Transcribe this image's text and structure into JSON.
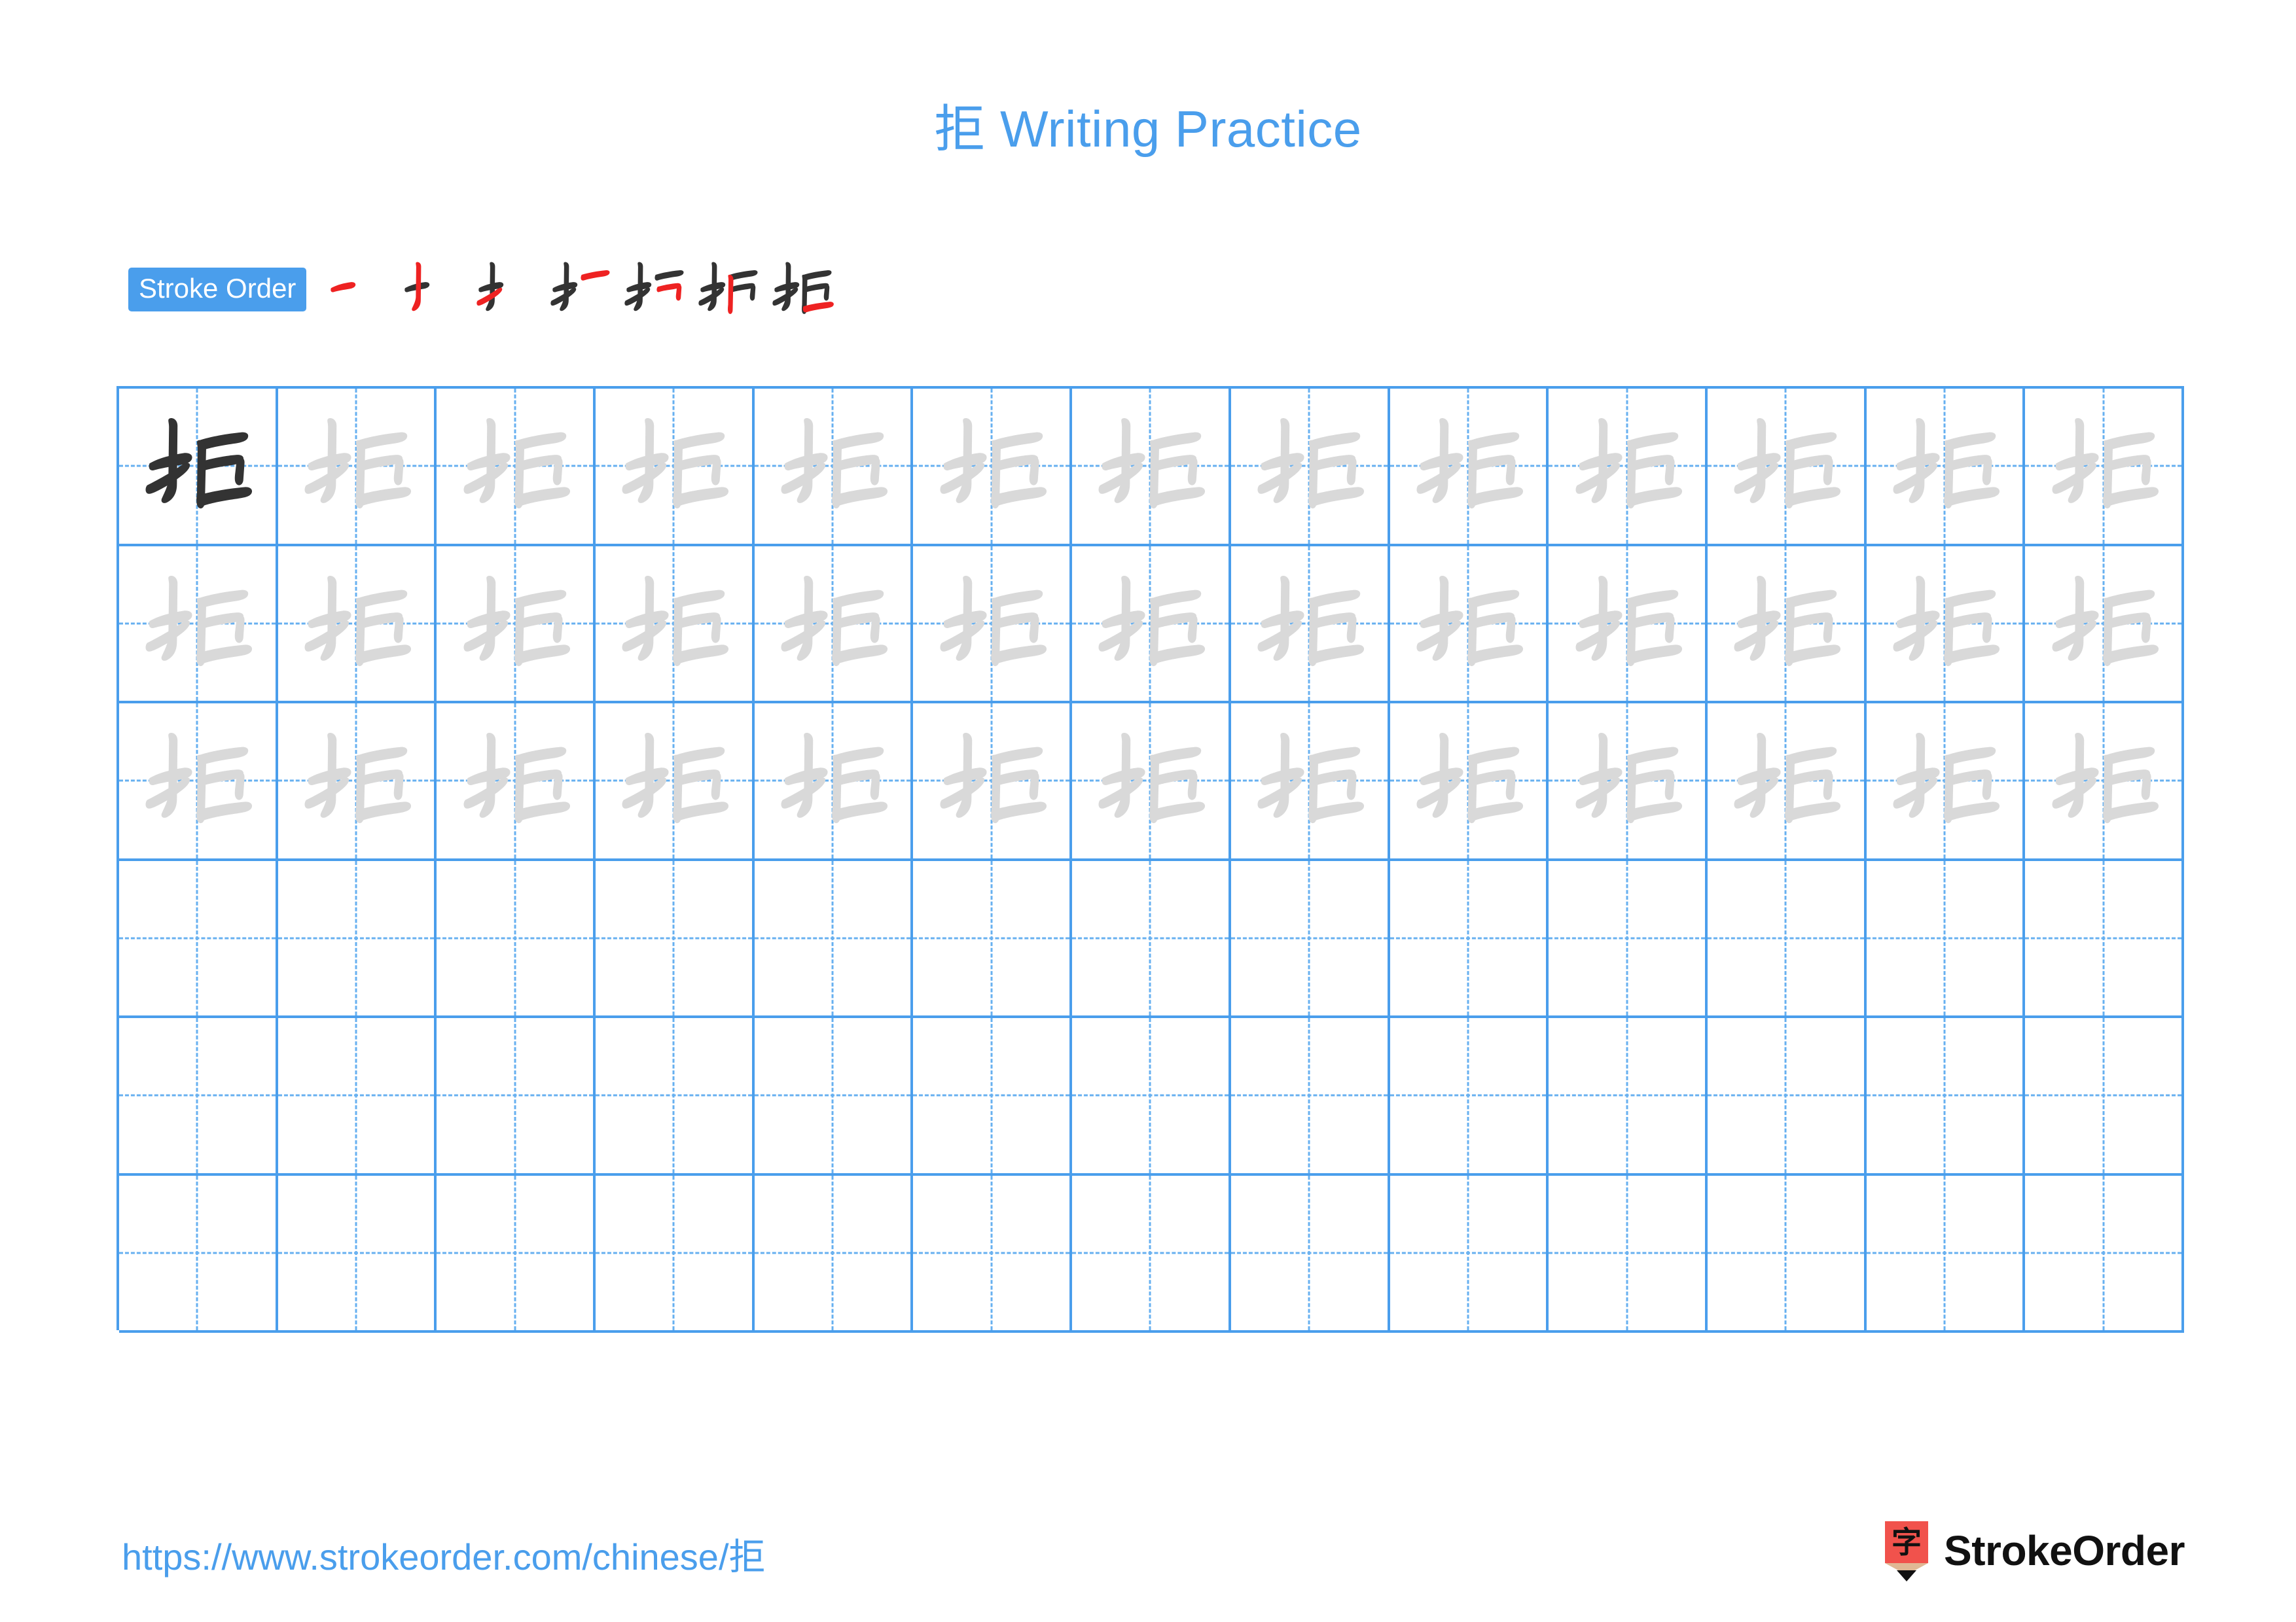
{
  "document": {
    "character": "拒",
    "title": "拒 Writing Practice",
    "accent_color": "#4a9eec",
    "grid_line_color": "#4a9eec",
    "dark_ink_color": "#333333",
    "light_ink_color": "#d9d9d9",
    "stroke_new_color": "#ee2222",
    "stroke_prev_color": "#333333",
    "background_color": "#ffffff"
  },
  "stroke_order": {
    "badge_label": "Stroke Order",
    "stroke_count": 7,
    "steps": [
      {
        "index": 1,
        "name": "stroke-step-1",
        "strokes_shown": 1
      },
      {
        "index": 2,
        "name": "stroke-step-2",
        "strokes_shown": 2
      },
      {
        "index": 3,
        "name": "stroke-step-3",
        "strokes_shown": 3
      },
      {
        "index": 4,
        "name": "stroke-step-4",
        "strokes_shown": 4
      },
      {
        "index": 5,
        "name": "stroke-step-5",
        "strokes_shown": 5
      },
      {
        "index": 6,
        "name": "stroke-step-6",
        "strokes_shown": 6
      },
      {
        "index": 7,
        "name": "stroke-step-7",
        "strokes_shown": 7
      }
    ]
  },
  "practice_grid": {
    "columns": 13,
    "rows": 6,
    "cell_states": [
      [
        "dark",
        "light",
        "light",
        "light",
        "light",
        "light",
        "light",
        "light",
        "light",
        "light",
        "light",
        "light",
        "light"
      ],
      [
        "light",
        "light",
        "light",
        "light",
        "light",
        "light",
        "light",
        "light",
        "light",
        "light",
        "light",
        "light",
        "light"
      ],
      [
        "light",
        "light",
        "light",
        "light",
        "light",
        "light",
        "light",
        "light",
        "light",
        "light",
        "light",
        "light",
        "light"
      ],
      [
        "empty",
        "empty",
        "empty",
        "empty",
        "empty",
        "empty",
        "empty",
        "empty",
        "empty",
        "empty",
        "empty",
        "empty",
        "empty"
      ],
      [
        "empty",
        "empty",
        "empty",
        "empty",
        "empty",
        "empty",
        "empty",
        "empty",
        "empty",
        "empty",
        "empty",
        "empty",
        "empty"
      ],
      [
        "empty",
        "empty",
        "empty",
        "empty",
        "empty",
        "empty",
        "empty",
        "empty",
        "empty",
        "empty",
        "empty",
        "empty",
        "empty"
      ]
    ]
  },
  "footer": {
    "url": "https://www.strokeorder.com/chinese/拒",
    "brand_name": "StrokeOrder",
    "brand_mark_character": "字",
    "brand_mark_color": "#f1524c",
    "brand_mark_tip_color": "#e0b894"
  }
}
